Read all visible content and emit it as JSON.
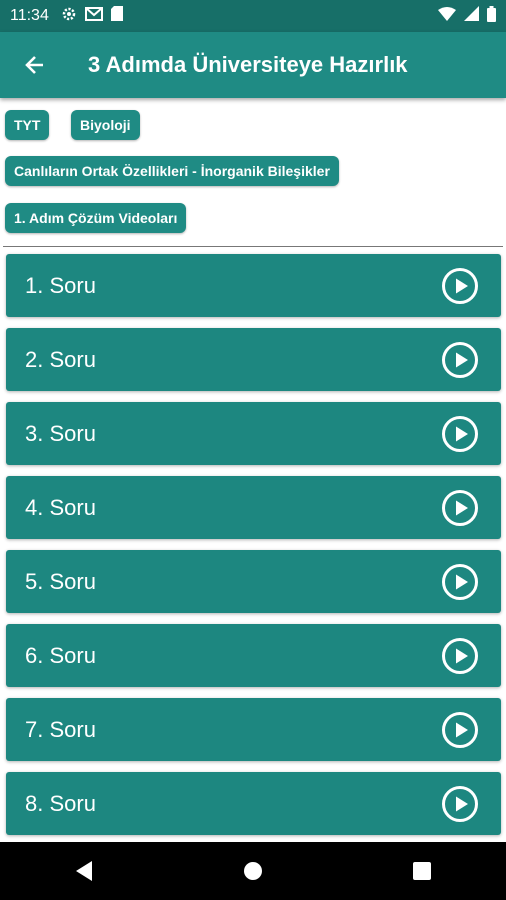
{
  "status_bar": {
    "time": "11:34"
  },
  "app_bar": {
    "title": "3 Adımda Üniversiteye Hazırlık"
  },
  "chips": {
    "exam": "TYT",
    "subject": "Biyoloji",
    "topic": "Canlıların Ortak Özellikleri - İnorganik Bileşikler",
    "step": "1. Adım Çözüm Videoları"
  },
  "questions": [
    {
      "label": "1. Soru"
    },
    {
      "label": "2. Soru"
    },
    {
      "label": "3. Soru"
    },
    {
      "label": "4. Soru"
    },
    {
      "label": "5. Soru"
    },
    {
      "label": "6. Soru"
    },
    {
      "label": "7. Soru"
    },
    {
      "label": "8. Soru"
    }
  ],
  "colors": {
    "status_bar": "#176f68",
    "app_bar": "#1f8b84",
    "list_item": "#1d8780"
  }
}
